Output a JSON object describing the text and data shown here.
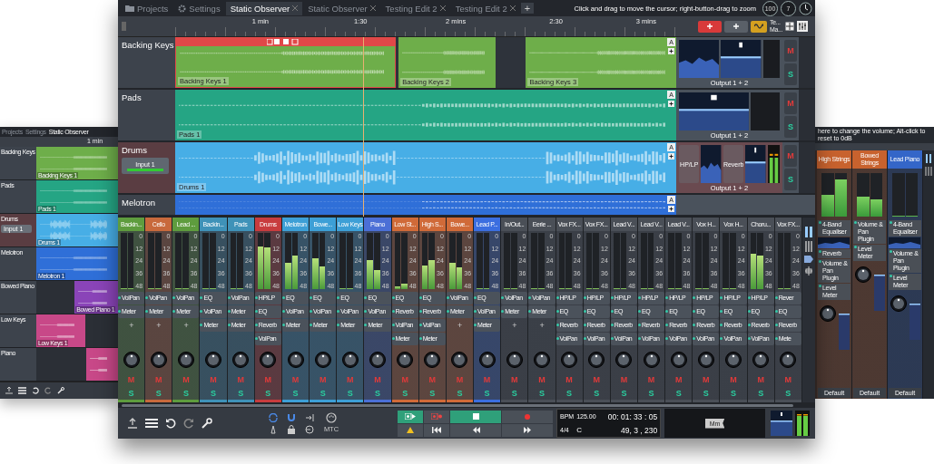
{
  "main_window": {
    "tabs": [
      {
        "label": "Projects",
        "kind": "projects",
        "selected": false
      },
      {
        "label": "Settings",
        "kind": "settings",
        "selected": false
      },
      {
        "label": "Static Observer",
        "kind": "edit",
        "selected": true
      },
      {
        "label": "Static Observer",
        "kind": "edit",
        "selected": false
      },
      {
        "label": "Testing Edit 2",
        "kind": "edit",
        "selected": false
      },
      {
        "label": "Testing Edit 2",
        "kind": "edit",
        "selected": false
      }
    ],
    "new_tab": "+",
    "hint": "Click and drag to move the cursor; right-button-drag to zoom",
    "round_buttons": [
      "100",
      "7"
    ],
    "ruler": [
      "1 min",
      "1:30",
      "2 mins",
      "2:30",
      "3 mins"
    ],
    "view_buttons": [
      "Te...",
      "Ma..."
    ],
    "tracks": [
      {
        "name": "Backing Keys",
        "color": "#6eae4a",
        "auto": "A",
        "output": "Output 1 + 2",
        "mute": "M",
        "solo": "S",
        "clips": [
          {
            "label": "Backing Keys 1",
            "selected": true
          },
          {
            "label": "Backing Keys 2",
            "selected": false
          },
          {
            "label": "Backing Keys 3",
            "selected": false
          }
        ],
        "devices": [
          {
            "kind": "graph"
          },
          {
            "kind": "fader"
          },
          {
            "kind": "slot"
          }
        ]
      },
      {
        "name": "Pads",
        "color": "#25a584",
        "auto": "A",
        "output": "Output 1 + 2",
        "mute": "M",
        "solo": "S",
        "clips": [
          {
            "label": "Pads 1",
            "selected": false
          }
        ],
        "devices": [
          {
            "kind": "fader"
          },
          {
            "kind": "slot"
          }
        ]
      },
      {
        "name": "Drums",
        "color": "#47aee6",
        "input": "Input 1",
        "auto": "A",
        "output": "Output 1 + 2",
        "mute": "M",
        "solo": "S",
        "clips": [
          {
            "label": "Drums 1",
            "selected": false
          }
        ],
        "devices": [
          {
            "kind": "plugin",
            "label": "HP/LP"
          },
          {
            "kind": "graph"
          },
          {
            "kind": "plugin",
            "label": "Reverb"
          },
          {
            "kind": "fader"
          },
          {
            "kind": "meter"
          }
        ]
      },
      {
        "name": "Melotron",
        "color": "#2f6fd8",
        "auto": "A",
        "clips": [
          {
            "selected": false
          }
        ]
      }
    ],
    "strips": [
      {
        "name": "Backin...",
        "color": "#5e9c3e",
        "scale": [
          "0",
          "12",
          "24",
          "36",
          "48"
        ],
        "meter": [
          {
            "level": 0
          },
          {
            "level": 0
          }
        ],
        "plugins": [
          {
            "kind": "plugin",
            "label": "VolPan"
          },
          {
            "kind": "plugin",
            "label": "Meter"
          },
          {
            "kind": "add",
            "label": "+"
          }
        ],
        "mute": "M",
        "solo": "S"
      },
      {
        "name": "Cello",
        "color": "#c8693c",
        "scale": [
          "0",
          "12",
          "24",
          "36",
          "48"
        ],
        "meter": [
          {
            "level": 0
          },
          {
            "level": 0
          }
        ],
        "plugins": [
          {
            "kind": "plugin",
            "label": "VolPan"
          },
          {
            "kind": "plugin",
            "label": "Meter"
          },
          {
            "kind": "add",
            "label": "+"
          }
        ],
        "mute": "M",
        "solo": "S"
      },
      {
        "name": "Lead ...",
        "color": "#5e9c3e",
        "scale": [
          "0",
          "12",
          "24",
          "36",
          "48"
        ],
        "meter": [
          {
            "level": 0
          },
          {
            "level": 0
          }
        ],
        "plugins": [
          {
            "kind": "plugin",
            "label": "VolPan"
          },
          {
            "kind": "plugin",
            "label": "Meter"
          },
          {
            "kind": "add",
            "label": "+"
          }
        ],
        "mute": "M",
        "solo": "S"
      },
      {
        "name": "Backin...",
        "color": "#3f92b8",
        "scale": [
          "0",
          "12",
          "24",
          "36",
          "48"
        ],
        "meter": [
          {
            "level": 0
          },
          {
            "level": 0
          }
        ],
        "plugins": [
          {
            "kind": "plugin",
            "label": "EQ"
          },
          {
            "kind": "plugin",
            "label": "VolPan"
          },
          {
            "kind": "plugin",
            "label": "Meter"
          }
        ],
        "mute": "M",
        "solo": "S"
      },
      {
        "name": "Pads",
        "color": "#3f92b8",
        "scale": [
          "0",
          "12",
          "24",
          "36",
          "48"
        ],
        "meter": [
          {
            "level": 0
          },
          {
            "level": 0
          }
        ],
        "plugins": [
          {
            "kind": "plugin",
            "label": "VolPan"
          },
          {
            "kind": "plugin",
            "label": "Meter"
          },
          {
            "kind": "plugin",
            "label": "Meter"
          }
        ],
        "mute": "M",
        "solo": "S"
      },
      {
        "name": "Drums",
        "color": "#c83c3e",
        "scale": [
          "0",
          "12",
          "24",
          "36",
          "48"
        ],
        "meter": [
          {
            "level": 0.76
          },
          {
            "level": 0.74
          }
        ],
        "plugins": [
          {
            "kind": "plugin",
            "label": "HP/LP"
          },
          {
            "kind": "plugin",
            "label": "EQ"
          },
          {
            "kind": "plugin",
            "label": "Reverb"
          },
          {
            "kind": "plugin",
            "label": "VolPan"
          }
        ],
        "mute": "M",
        "solo": "S"
      },
      {
        "name": "Melotron",
        "color": "#3d9fd6",
        "scale": [
          "0",
          "12",
          "24",
          "36",
          "48"
        ],
        "meter": [
          {
            "level": 0.46
          },
          {
            "level": 0.6
          }
        ],
        "plugins": [
          {
            "kind": "plugin",
            "label": "EQ"
          },
          {
            "kind": "plugin",
            "label": "VolPan"
          },
          {
            "kind": "plugin",
            "label": "Meter"
          }
        ],
        "mute": "M",
        "solo": "S"
      },
      {
        "name": "Bowe...",
        "color": "#3d9fd6",
        "scale": [
          "0",
          "12",
          "24",
          "36",
          "48"
        ],
        "meter": [
          {
            "level": 0.54
          },
          {
            "level": 0.4
          }
        ],
        "plugins": [
          {
            "kind": "plugin",
            "label": "EQ"
          },
          {
            "kind": "plugin",
            "label": "VolPan"
          },
          {
            "kind": "plugin",
            "label": "Meter"
          }
        ],
        "mute": "M",
        "solo": "S"
      },
      {
        "name": "Low Keys",
        "color": "#3d9fd6",
        "scale": [
          "0",
          "12",
          "24",
          "36",
          "48"
        ],
        "meter": [
          {
            "level": 0
          },
          {
            "level": 0
          }
        ],
        "plugins": [
          {
            "kind": "plugin",
            "label": "EQ"
          },
          {
            "kind": "plugin",
            "label": "VolPan"
          },
          {
            "kind": "plugin",
            "label": "Meter"
          }
        ],
        "mute": "M",
        "solo": "S"
      },
      {
        "name": "Piano",
        "color": "#4b6fd6",
        "scale": [
          "0",
          "12",
          "24",
          "36",
          "48"
        ],
        "meter": [
          {
            "level": 0.52
          },
          {
            "level": 0.34
          }
        ],
        "plugins": [
          {
            "kind": "plugin",
            "label": "EQ"
          },
          {
            "kind": "plugin",
            "label": "VolPan"
          },
          {
            "kind": "plugin",
            "label": "Meter"
          }
        ],
        "mute": "M",
        "solo": "S"
      },
      {
        "name": "Low St...",
        "color": "#d06a38",
        "scale": [
          "0",
          "12",
          "24",
          "36",
          "48"
        ],
        "meter": [
          {
            "level": 0.05
          },
          {
            "level": 0.1
          }
        ],
        "plugins": [
          {
            "kind": "plugin",
            "label": "EQ"
          },
          {
            "kind": "plugin",
            "label": "Reverb"
          },
          {
            "kind": "plugin",
            "label": "VolPan"
          },
          {
            "kind": "plugin",
            "label": "Meter"
          }
        ],
        "mute": "M",
        "solo": "S"
      },
      {
        "name": "High S...",
        "color": "#d06a38",
        "scale": [
          "0",
          "12",
          "24",
          "36",
          "48"
        ],
        "meter": [
          {
            "level": 0.42
          },
          {
            "level": 0.52
          }
        ],
        "plugins": [
          {
            "kind": "plugin",
            "label": "EQ"
          },
          {
            "kind": "plugin",
            "label": "Reverb"
          },
          {
            "kind": "plugin",
            "label": "VolPan"
          },
          {
            "kind": "plugin",
            "label": "Meter"
          }
        ],
        "mute": "M",
        "solo": "S"
      },
      {
        "name": "Bowe...",
        "color": "#d06a38",
        "scale": [
          "0",
          "12",
          "24",
          "36",
          "48"
        ],
        "meter": [
          {
            "level": 0.46
          },
          {
            "level": 0.38
          }
        ],
        "plugins": [
          {
            "kind": "plugin",
            "label": "VolPan"
          },
          {
            "kind": "plugin",
            "label": "Meter"
          },
          {
            "kind": "add",
            "label": "+"
          }
        ],
        "mute": "M",
        "solo": "S"
      },
      {
        "name": "Lead P...",
        "color": "#3b6ee0",
        "scale": [
          "0",
          "12",
          "24",
          "36",
          "48"
        ],
        "meter": [
          {
            "level": 0
          },
          {
            "level": 0
          }
        ],
        "plugins": [
          {
            "kind": "plugin",
            "label": "EQ"
          },
          {
            "kind": "plugin",
            "label": "VolPan"
          },
          {
            "kind": "plugin",
            "label": "Meter"
          }
        ],
        "mute": "M",
        "solo": "S"
      },
      {
        "name": "In/Out...",
        "color": "#4a4f57",
        "scale": [
          "0",
          "12",
          "24",
          "36",
          "48"
        ],
        "meter": [
          {
            "level": 0
          },
          {
            "level": 0
          }
        ],
        "plugins": [
          {
            "kind": "plugin",
            "label": "VolPan"
          },
          {
            "kind": "plugin",
            "label": "Meter"
          },
          {
            "kind": "add",
            "label": "+"
          }
        ],
        "mute": "M",
        "solo": "S"
      },
      {
        "name": "Eerie ...",
        "color": "#4a4f57",
        "scale": [
          "0",
          "12",
          "24",
          "36",
          "48"
        ],
        "meter": [
          {
            "level": 0
          },
          {
            "level": 0
          }
        ],
        "plugins": [
          {
            "kind": "plugin",
            "label": "VolPan"
          },
          {
            "kind": "plugin",
            "label": "Meter"
          },
          {
            "kind": "add",
            "label": "+"
          }
        ],
        "mute": "M",
        "solo": "S"
      },
      {
        "name": "Vox FX...",
        "color": "#4a4f57",
        "scale": [
          "0",
          "12",
          "24",
          "36",
          "48"
        ],
        "meter": [
          {
            "level": 0
          },
          {
            "level": 0
          }
        ],
        "plugins": [
          {
            "kind": "plugin",
            "label": "HP/LP"
          },
          {
            "kind": "plugin",
            "label": "EQ"
          },
          {
            "kind": "plugin",
            "label": "Reverb"
          },
          {
            "kind": "plugin",
            "label": "VolPan"
          }
        ],
        "mute": "M",
        "solo": "S"
      },
      {
        "name": "Vox FX...",
        "color": "#4a4f57",
        "scale": [
          "0",
          "12",
          "24",
          "36",
          "48"
        ],
        "meter": [
          {
            "level": 0
          },
          {
            "level": 0
          }
        ],
        "plugins": [
          {
            "kind": "plugin",
            "label": "HP/LP"
          },
          {
            "kind": "plugin",
            "label": "EQ"
          },
          {
            "kind": "plugin",
            "label": "Reverb"
          },
          {
            "kind": "plugin",
            "label": "VolPan"
          }
        ],
        "mute": "M",
        "solo": "S"
      },
      {
        "name": "Lead V...",
        "color": "#4a4f57",
        "scale": [
          "0",
          "12",
          "24",
          "36",
          "48"
        ],
        "meter": [
          {
            "level": 0
          },
          {
            "level": 0
          }
        ],
        "plugins": [
          {
            "kind": "plugin",
            "label": "HP/LP"
          },
          {
            "kind": "plugin",
            "label": "EQ"
          },
          {
            "kind": "plugin",
            "label": "Reverb"
          },
          {
            "kind": "plugin",
            "label": "VolPan"
          }
        ],
        "mute": "M",
        "solo": "S"
      },
      {
        "name": "Lead V...",
        "color": "#4a4f57",
        "scale": [
          "0",
          "12",
          "24",
          "36",
          "48"
        ],
        "meter": [
          {
            "level": 0
          },
          {
            "level": 0
          }
        ],
        "plugins": [
          {
            "kind": "plugin",
            "label": "HP/LP"
          },
          {
            "kind": "plugin",
            "label": "EQ"
          },
          {
            "kind": "plugin",
            "label": "Reverb"
          },
          {
            "kind": "plugin",
            "label": "VolPan"
          }
        ],
        "mute": "M",
        "solo": "S"
      },
      {
        "name": "Lead V...",
        "color": "#4a4f57",
        "scale": [
          "0",
          "12",
          "24",
          "36",
          "48"
        ],
        "meter": [
          {
            "level": 0
          },
          {
            "level": 0
          }
        ],
        "plugins": [
          {
            "kind": "plugin",
            "label": "HP/LP"
          },
          {
            "kind": "plugin",
            "label": "EQ"
          },
          {
            "kind": "plugin",
            "label": "Reverb"
          },
          {
            "kind": "plugin",
            "label": "VolPan"
          }
        ],
        "mute": "M",
        "solo": "S"
      },
      {
        "name": "Vox H...",
        "color": "#4a4f57",
        "scale": [
          "0",
          "12",
          "24",
          "36",
          "48"
        ],
        "meter": [
          {
            "level": 0
          },
          {
            "level": 0
          }
        ],
        "plugins": [
          {
            "kind": "plugin",
            "label": "HP/LP"
          },
          {
            "kind": "plugin",
            "label": "EQ"
          },
          {
            "kind": "plugin",
            "label": "Reverb"
          },
          {
            "kind": "plugin",
            "label": "VolPan"
          }
        ],
        "mute": "M",
        "solo": "S"
      },
      {
        "name": "Vox H...",
        "color": "#4a4f57",
        "scale": [
          "0",
          "12",
          "24",
          "36",
          "48"
        ],
        "meter": [
          {
            "level": 0
          },
          {
            "level": 0
          }
        ],
        "plugins": [
          {
            "kind": "plugin",
            "label": "HP/LP"
          },
          {
            "kind": "plugin",
            "label": "EQ"
          },
          {
            "kind": "plugin",
            "label": "Reverb"
          },
          {
            "kind": "plugin",
            "label": "VolPan"
          }
        ],
        "mute": "M",
        "solo": "S"
      },
      {
        "name": "Choru...",
        "color": "#4a4f57",
        "scale": [
          "0",
          "12",
          "24",
          "36",
          "48"
        ],
        "meter": [
          {
            "level": 0.62
          },
          {
            "level": 0.6
          }
        ],
        "plugins": [
          {
            "kind": "plugin",
            "label": "HP/LP"
          },
          {
            "kind": "plugin",
            "label": "EQ"
          },
          {
            "kind": "plugin",
            "label": "Reverb"
          },
          {
            "kind": "plugin",
            "label": "VolPan"
          }
        ],
        "mute": "M",
        "solo": "S"
      },
      {
        "name": "Vox FX...",
        "color": "#4a4f57",
        "scale": [
          "0",
          "12",
          "24",
          "36",
          "48"
        ],
        "meter": [
          {
            "level": 0
          },
          {
            "level": 0
          }
        ],
        "plugins": [
          {
            "kind": "plugin",
            "label": "Rever"
          },
          {
            "kind": "plugin",
            "label": "EQ"
          },
          {
            "kind": "plugin",
            "label": "Reverb"
          },
          {
            "kind": "plugin",
            "label": "Mete"
          }
        ],
        "mute": "M",
        "solo": "S"
      }
    ],
    "transport": {
      "sync": "MTC",
      "bpm_label": "BPM",
      "bpm": "125.00",
      "time": "00: 01: 33 : 05",
      "signature": "4/4",
      "key": "C",
      "position": "49, 3 , 230",
      "mode_button": "Mm"
    }
  },
  "left_window": {
    "tabs": [
      {
        "label": "Projects",
        "selected": false
      },
      {
        "label": "Settings",
        "selected": false
      },
      {
        "label": "Static Observer",
        "selected": true
      }
    ],
    "ruler": [
      "1 min"
    ],
    "tracks": [
      {
        "name": "Backing Keys",
        "color": "#6eae4a",
        "clip_label": "Backing Keys 1"
      },
      {
        "name": "Pads",
        "color": "#25a584",
        "clip_label": "Pads 1"
      },
      {
        "name": "Drums",
        "color": "#47aee6",
        "input": "Input 1",
        "clip_label": "Drums 1"
      },
      {
        "name": "Melotron",
        "color": "#2f6fd8",
        "clip_label": "Melotron 1"
      },
      {
        "name": "Bowed Piano",
        "color": "#8a44b8",
        "clip_label": "Bowed Piano 1"
      },
      {
        "name": "Low Keys",
        "color": "#c84888",
        "clip_label": "Low Keys 1"
      },
      {
        "name": "Piano",
        "color": "#c84888"
      }
    ]
  },
  "right_window": {
    "hint": "here to change the volume; Alt-click to reset to 0dB",
    "strips": [
      {
        "name": "High Strings",
        "color": "#c8622e",
        "meter": [
          {
            "level": 0.5
          },
          {
            "level": 0.85
          }
        ],
        "plugins": [
          {
            "kind": "plugin",
            "label": "4-Band Equaliser"
          },
          {
            "kind": "graph"
          },
          {
            "kind": "plugin",
            "label": "Reverb"
          },
          {
            "kind": "plugin",
            "label": "Volume & Pan Plugin"
          },
          {
            "kind": "plugin",
            "label": "Level Meter"
          }
        ],
        "preset": "Default"
      },
      {
        "name": "Bowed Strings",
        "color": "#c8622e",
        "meter": [
          {
            "level": 0.45
          },
          {
            "level": 0.4
          }
        ],
        "plugins": [
          {
            "kind": "plugin",
            "label": "Volume & Pan Plugin"
          },
          {
            "kind": "plugin",
            "label": "Level Meter"
          }
        ],
        "preset": "Default"
      },
      {
        "name": "Lead Piano",
        "color": "#3466c8",
        "meter": [
          {
            "level": 0
          },
          {
            "level": 0
          }
        ],
        "plugins": [
          {
            "kind": "plugin",
            "label": "4-Band Equaliser"
          },
          {
            "kind": "graph"
          },
          {
            "kind": "plugin",
            "label": "Volume & Pan Plugin"
          },
          {
            "kind": "plugin",
            "label": "Level Meter"
          }
        ],
        "preset": "Default"
      }
    ]
  }
}
